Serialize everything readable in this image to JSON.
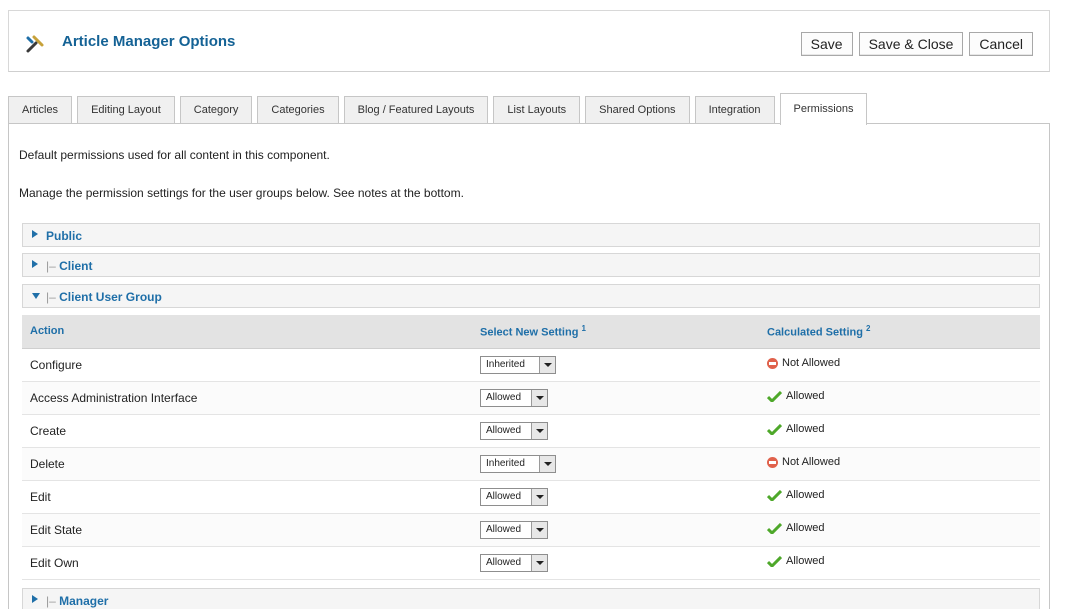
{
  "header": {
    "title": "Article Manager Options",
    "icon": "tools-icon"
  },
  "toolbar": {
    "save_label": "Save",
    "save_close_label": "Save & Close",
    "cancel_label": "Cancel"
  },
  "tabs": [
    {
      "label": "Articles"
    },
    {
      "label": "Editing Layout"
    },
    {
      "label": "Category"
    },
    {
      "label": "Categories"
    },
    {
      "label": "Blog / Featured Layouts"
    },
    {
      "label": "List Layouts"
    },
    {
      "label": "Shared Options"
    },
    {
      "label": "Integration"
    },
    {
      "label": "Permissions",
      "active": true
    }
  ],
  "content": {
    "description_1": "Default permissions used for all content in this component.",
    "description_2": "Manage the permission settings for the user groups below. See notes at the bottom."
  },
  "groups": [
    {
      "prefix": "",
      "label": "Public",
      "expanded": false
    },
    {
      "prefix": "|– ",
      "label": "Client",
      "expanded": false
    },
    {
      "prefix": "|– ",
      "label": "Client User Group",
      "expanded": true
    },
    {
      "prefix": "|– ",
      "label": "Manager",
      "expanded": false
    }
  ],
  "table": {
    "headers": {
      "action": "Action",
      "select": "Select New Setting",
      "select_note": "1",
      "calculated": "Calculated Setting",
      "calculated_note": "2"
    },
    "rows": [
      {
        "action": "Configure",
        "setting": "Inherited",
        "calculated": "Not Allowed",
        "status": "denied"
      },
      {
        "action": "Access Administration Interface",
        "setting": "Allowed",
        "calculated": "Allowed",
        "status": "allowed"
      },
      {
        "action": "Create",
        "setting": "Allowed",
        "calculated": "Allowed",
        "status": "allowed"
      },
      {
        "action": "Delete",
        "setting": "Inherited",
        "calculated": "Not Allowed",
        "status": "denied"
      },
      {
        "action": "Edit",
        "setting": "Allowed",
        "calculated": "Allowed",
        "status": "allowed"
      },
      {
        "action": "Edit State",
        "setting": "Allowed",
        "calculated": "Allowed",
        "status": "allowed"
      },
      {
        "action": "Edit Own",
        "setting": "Allowed",
        "calculated": "Allowed",
        "status": "allowed"
      }
    ]
  },
  "colors": {
    "link_blue": "#1f6fa8",
    "title_blue": "#146295",
    "allowed_green": "#4ea82a",
    "denied_red": "#e0614b"
  }
}
